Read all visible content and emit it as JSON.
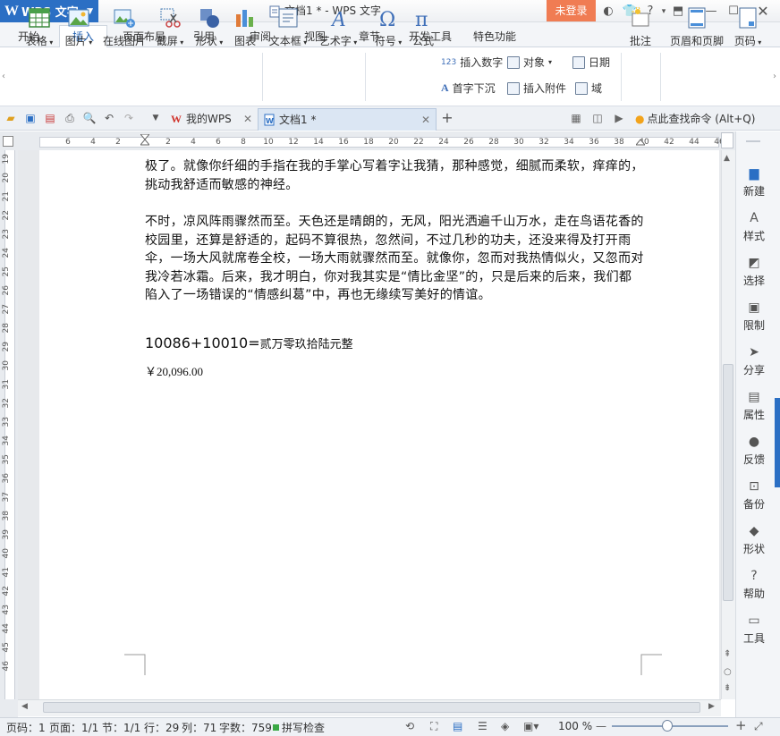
{
  "app": {
    "name": "WPS 文字",
    "logo_letter": "W",
    "doc_title": "文档1 * - WPS 文字",
    "login_label": "未登录"
  },
  "menu_tabs": [
    {
      "label": "开始"
    },
    {
      "label": "插入"
    },
    {
      "label": "页面布局"
    },
    {
      "label": "引用"
    },
    {
      "label": "审阅"
    },
    {
      "label": "视图"
    },
    {
      "label": "章节"
    },
    {
      "label": "开发工具"
    },
    {
      "label": "特色功能"
    }
  ],
  "active_tab": "插入",
  "ribbon": {
    "table": "表格",
    "picture": "图片",
    "online_picture": "在线图片",
    "screenshot": "截屏",
    "shape": "形状",
    "chart": "图表",
    "textbox": "文本框",
    "wordart": "艺术字",
    "symbol": "符号",
    "formula": "公式",
    "insert_number": "插入数字",
    "object": "对象",
    "date": "日期",
    "dropcap": "首字下沉",
    "attachment": "插入附件",
    "field": "域",
    "comment": "批注",
    "header_footer": "页眉和页脚",
    "page_number": "页码"
  },
  "quick_access": {
    "my_wps_tab": "我的WPS",
    "doc_tab": "文档1 *",
    "search_hint": "点此查找命令 (Alt+Q)"
  },
  "ruler": {
    "h_ticks": [
      "6",
      "4",
      "2",
      "",
      "2",
      "4",
      "6",
      "8",
      "10",
      "12",
      "14",
      "16",
      "18",
      "20",
      "22",
      "24",
      "26",
      "28",
      "30",
      "32",
      "34",
      "36",
      "38",
      "40",
      "42",
      "44",
      "46"
    ],
    "v_ticks": [
      "19",
      "20",
      "21",
      "22",
      "23",
      "24",
      "25",
      "26",
      "27",
      "28",
      "29",
      "30",
      "31",
      "32",
      "33",
      "34",
      "35",
      "36",
      "37",
      "38",
      "39",
      "40",
      "41",
      "42",
      "43",
      "44",
      "45",
      "46"
    ]
  },
  "document": {
    "para1": "极了。就像你纤细的手指在我的手掌心写着字让我猜，那种感觉，细腻而柔软，痒痒的，挑动我舒适而敏感的神经。",
    "para2": "不时，凉风阵雨骤然而至。天色还是晴朗的，无风，阳光洒遍千山万水，走在鸟语花香的校园里，还算是舒适的，起码不算很热，忽然间，不过几秒的功夫，还没来得及打开雨伞，一场大风就席卷全校，一场大雨就骤然而至。就像你，忽而对我热情似火，又忽而对我冷若冰霜。后来，我才明白，你对我其实是“情比金坚”的，只是后来的后来，我们都陷入了一场错误的“情感纠葛”中，再也无缘续写美好的情谊。",
    "formula_expr": "10086+10010=",
    "formula_cn": "贰万零玖拾陆元整",
    "amount": "￥20,096.00"
  },
  "side_panel": [
    "新建",
    "样式",
    "选择",
    "限制",
    "分享",
    "属性",
    "反馈",
    "备份",
    "形状",
    "帮助",
    "工具"
  ],
  "status_bar": {
    "page_code": "页码：1",
    "pages": "页面：1/1",
    "section": "节：1/1",
    "row": "行：29",
    "col": "列：71",
    "word_count": "字数：759",
    "spell_check": "拼写检查",
    "zoom": "100 %"
  },
  "zoom_level_percent": 100,
  "colors": {
    "accent": "#2b6fc4",
    "login": "#f07c53"
  }
}
